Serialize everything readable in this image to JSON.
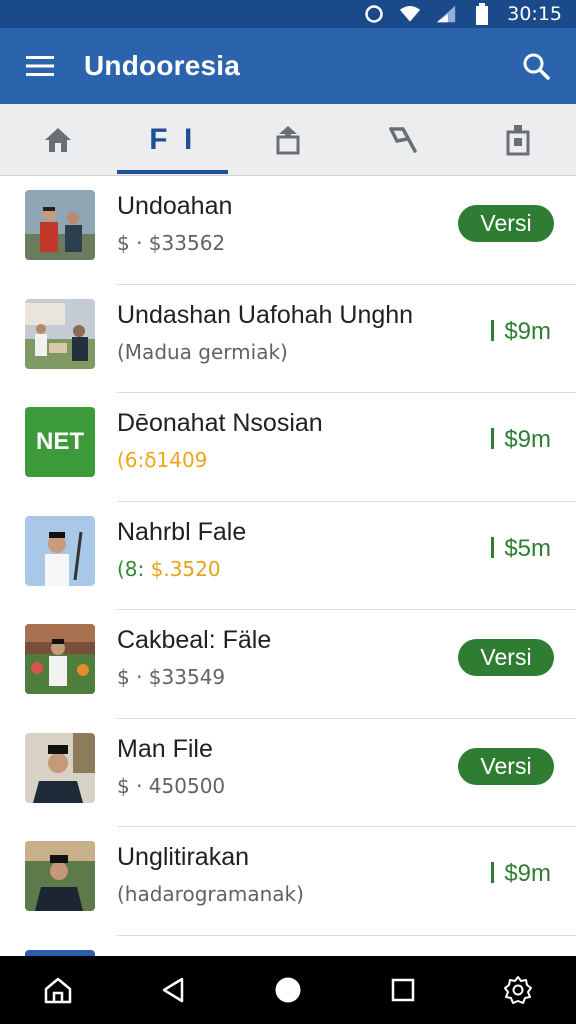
{
  "status": {
    "time": "30:15"
  },
  "appbar": {
    "title": "Undooresia"
  },
  "tabs": [
    {
      "icon": "home-icon"
    },
    {
      "label": "F I"
    },
    {
      "icon": "upload-icon"
    },
    {
      "icon": "tag-icon"
    },
    {
      "icon": "jar-icon"
    }
  ],
  "items": [
    {
      "title": "Undoahan",
      "sub": "$ · $33562",
      "action": "Versi"
    },
    {
      "title": "Undashan Uafohah Unghn",
      "sub": "(Madua germiak)",
      "price": "$9m"
    },
    {
      "thumb_label": "NET",
      "title": "Dēonahat Nsosian",
      "sub": "(6:δ1409",
      "price": "$9m"
    },
    {
      "title": "Nahrbl Fale",
      "sub_a": "(8: ",
      "sub_b": "$.3520",
      "price": "$5m"
    },
    {
      "title": "Cakbeal: Fäle",
      "sub": "$ · $33549",
      "action": "Versi"
    },
    {
      "title": "Man File",
      "sub": "$ · 450500",
      "action": "Versi"
    },
    {
      "title": "Unglitirakan",
      "sub": "(hadarogramanak)",
      "price": "$9m"
    }
  ],
  "colors": {
    "statusbar": "#1a4a8a",
    "appbar": "#2b63ad",
    "accent_green": "#2f7d32",
    "tab_active": "#1f4f95"
  }
}
